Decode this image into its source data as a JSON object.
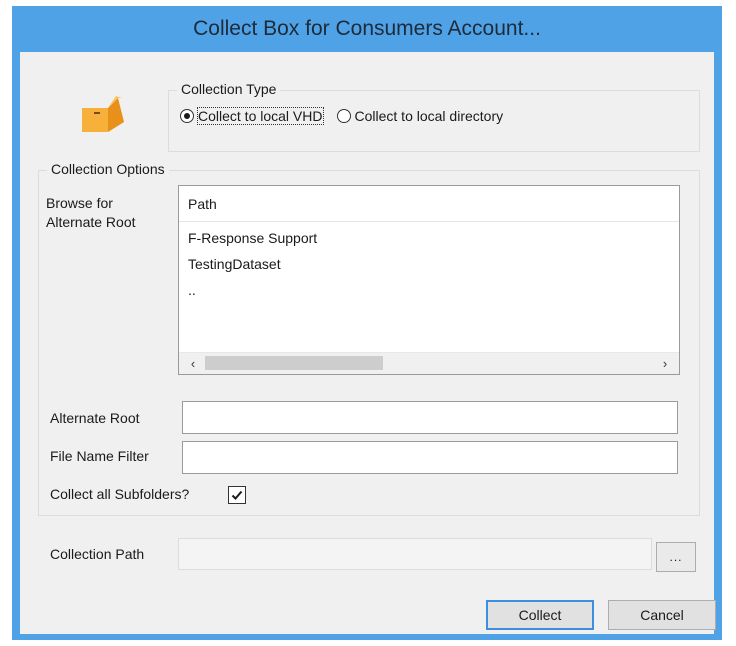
{
  "window": {
    "title": "Collect Box for Consumers Account..."
  },
  "icons": {
    "box": "cardboard-box-icon"
  },
  "collection_type": {
    "legend": "Collection Type",
    "options": [
      {
        "label": "Collect to local VHD",
        "selected": true
      },
      {
        "label": "Collect to local directory",
        "selected": false
      }
    ]
  },
  "collection_options": {
    "legend": "Collection Options",
    "browse_label_line1": "Browse for",
    "browse_label_line2": "Alternate Root",
    "list": {
      "column_header": "Path",
      "rows": [
        "F-Response Support",
        "TestingDataset",
        ".."
      ],
      "scroll_left": "‹",
      "scroll_right": "›"
    },
    "alternate_root_label": "Alternate Root",
    "alternate_root_value": "",
    "file_name_filter_label": "File Name Filter",
    "file_name_filter_value": "",
    "collect_subfolders_label": "Collect all Subfolders?",
    "collect_subfolders_checked": true
  },
  "collection_path": {
    "label": "Collection Path",
    "value": "",
    "browse_label": "..."
  },
  "buttons": {
    "collect": "Collect",
    "cancel": "Cancel"
  },
  "colors": {
    "titlebar": "#4fa2e6",
    "client": "#f0f0f0",
    "icon_orange": "#f5a623",
    "default_button_border": "#3c8ee0"
  }
}
